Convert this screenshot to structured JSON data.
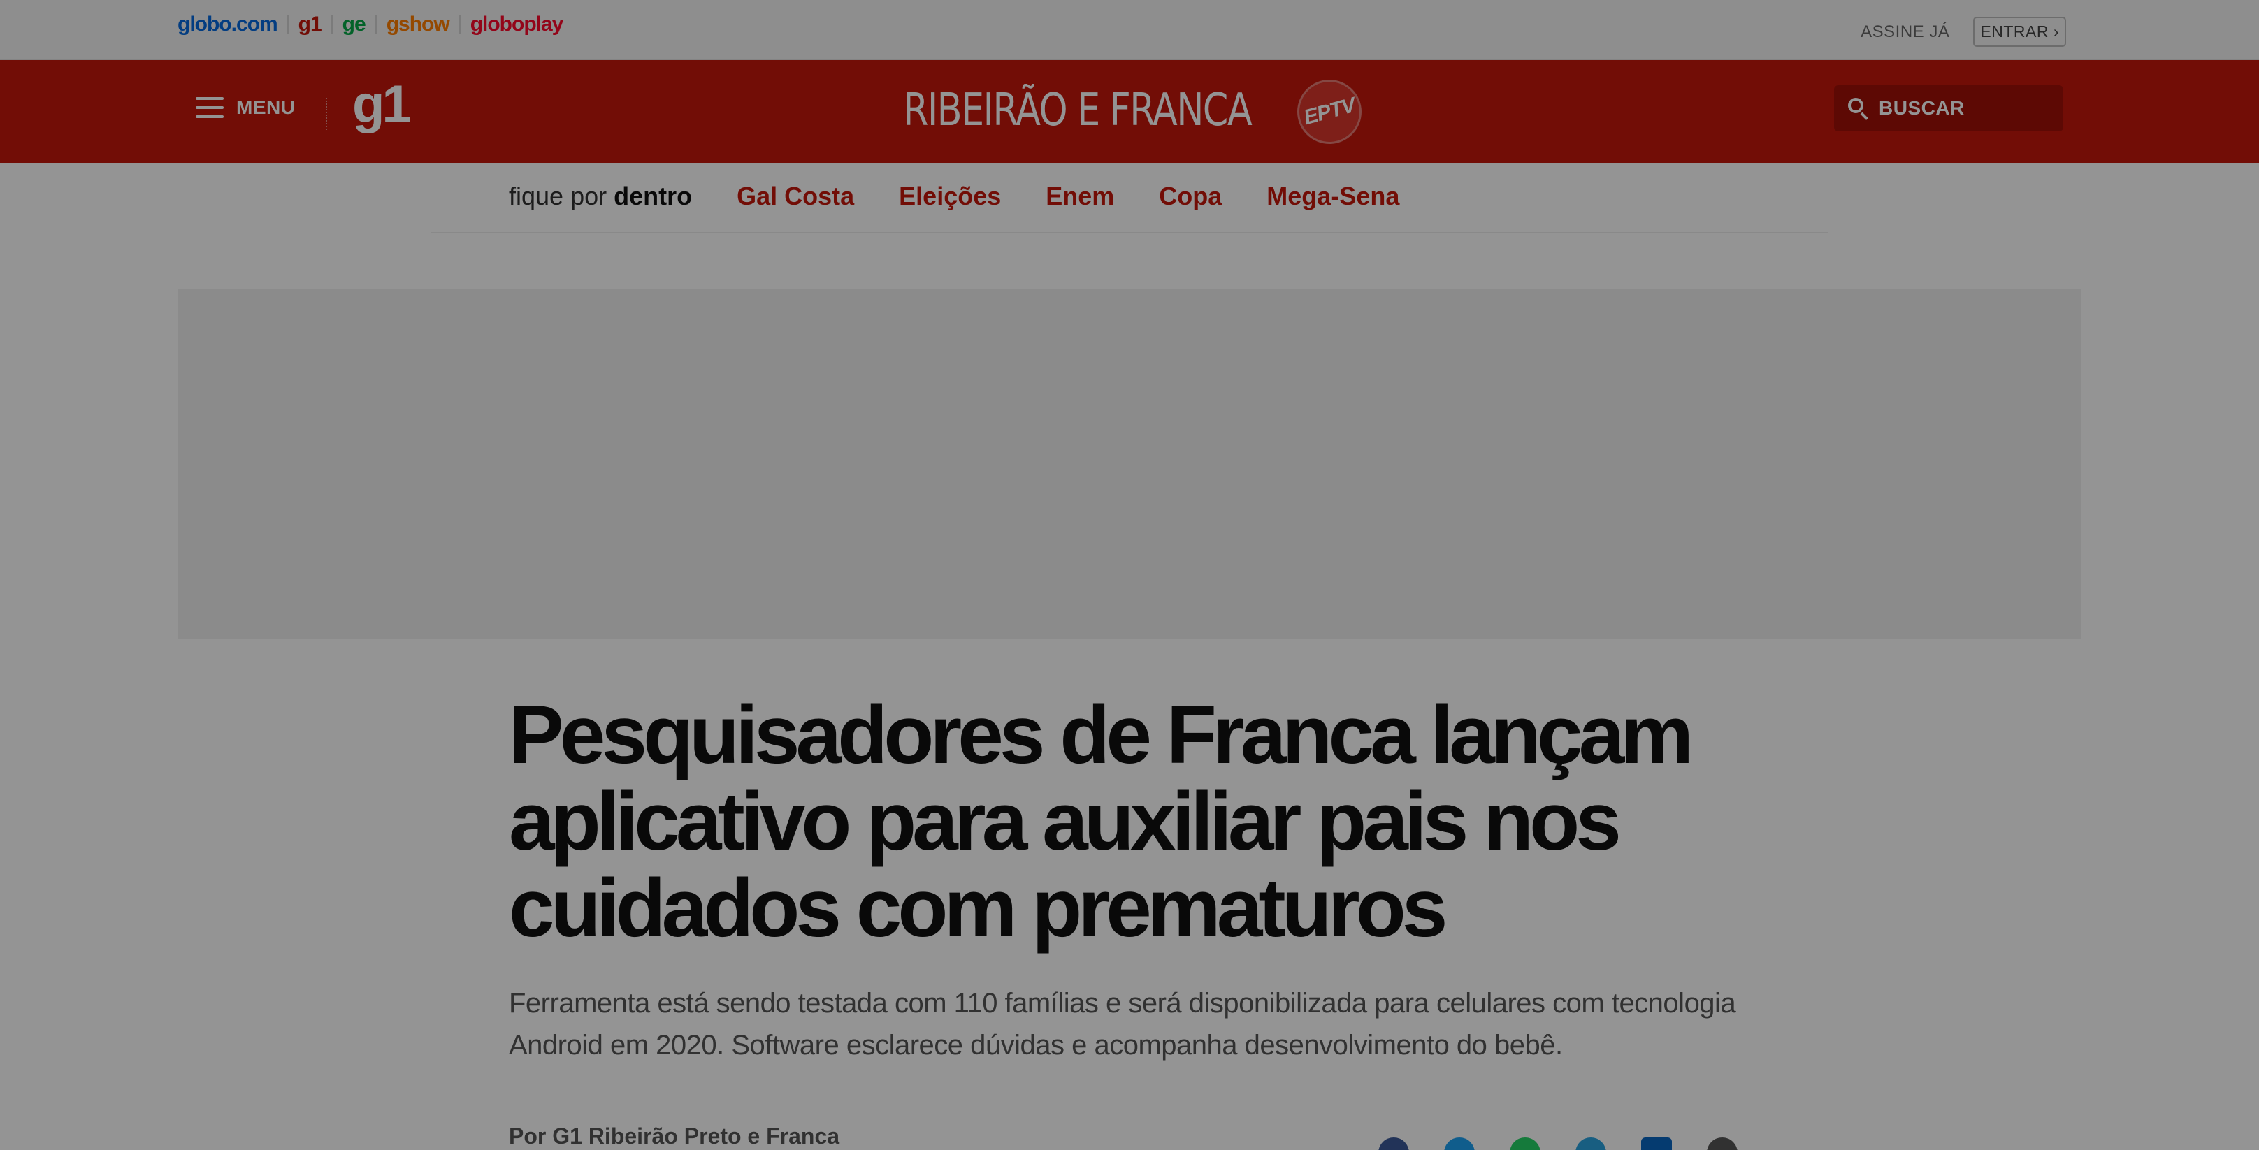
{
  "globo_bar": {
    "links": [
      {
        "label": "globo.com",
        "color": "#0669de"
      },
      {
        "label": "g1",
        "color": "#c4170c"
      },
      {
        "label": "ge",
        "color": "#06aa48"
      },
      {
        "label": "gshow",
        "color": "#ff7f00"
      },
      {
        "label": "globoplay",
        "color": "#fd0a2c"
      }
    ],
    "assine": "ASSINE JÁ",
    "entrar": "ENTRAR ›"
  },
  "header": {
    "menu_label": "MENU",
    "logo": "g1",
    "region": "RIBEIRÃO E FRANCA",
    "affiliate_badge": "EPTV",
    "search_label": "BUSCAR",
    "brand_color": "#c4170c"
  },
  "topics": {
    "lead_light": "fique por ",
    "lead_bold": "dentro",
    "items": [
      "Gal Costa",
      "Eleições",
      "Enem",
      "Copa",
      "Mega-Sena"
    ]
  },
  "article": {
    "headline": "Pesquisadores de Franca lançam aplicativo para auxiliar pais nos cuidados com prematuros",
    "subtitle": "Ferramenta está sendo testada com 110 famílias e será disponibilizada para celulares com tecnologia Android em 2020. Software esclarece dúvidas e acompanha desenvolvimento do bebê.",
    "byline": "Por G1 Ribeirão Preto e Franca"
  },
  "share_icons": [
    "facebook-icon",
    "twitter-icon",
    "whatsapp-icon",
    "telegram-icon",
    "linkedin-icon",
    "link-icon"
  ]
}
